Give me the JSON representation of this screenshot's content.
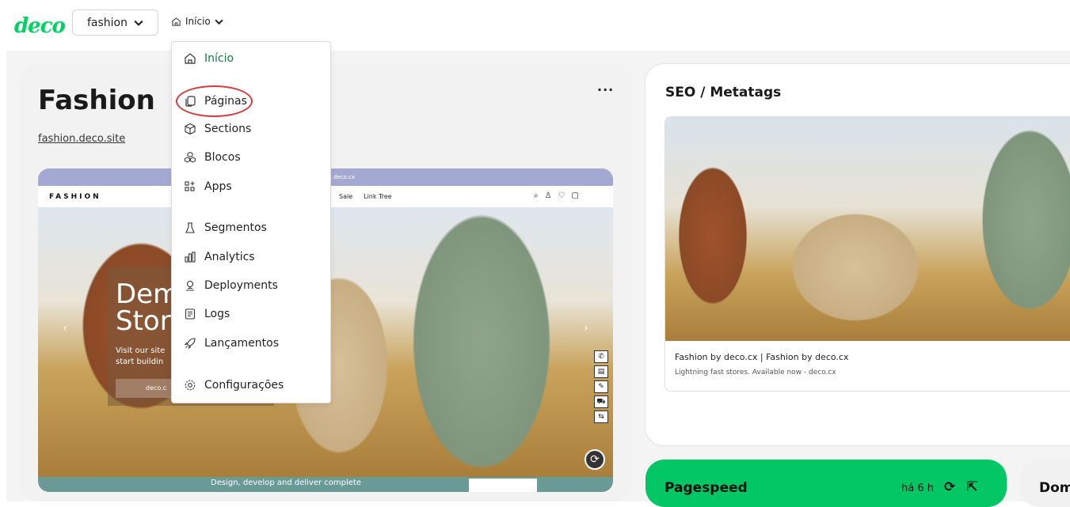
{
  "topbar": {
    "logo": "deco",
    "site_selector": "fashion",
    "breadcrumb": "Início"
  },
  "site": {
    "title": "Fashion",
    "url": "fashion.deco.site",
    "more": "···"
  },
  "preview": {
    "banner": "your store at deco.cx",
    "brand": "FASHION",
    "nav_links": [
      "Sale",
      "Link Tree"
    ],
    "hero_title": "Dem\nStor",
    "hero_sub": "Visit our site\nstart buildin",
    "hero_button": "deco.c",
    "footer_text": "Design, develop and deliver complete"
  },
  "menu": {
    "items": [
      {
        "label": "Início",
        "icon": "home-icon"
      },
      {
        "label": "Páginas",
        "icon": "pages-icon"
      },
      {
        "label": "Sections",
        "icon": "cube-icon"
      },
      {
        "label": "Blocos",
        "icon": "blocks-icon"
      },
      {
        "label": "Apps",
        "icon": "apps-icon"
      },
      {
        "label": "Segmentos",
        "icon": "flask-icon"
      },
      {
        "label": "Analytics",
        "icon": "chart-icon"
      },
      {
        "label": "Deployments",
        "icon": "deploy-icon"
      },
      {
        "label": "Logs",
        "icon": "logs-icon"
      },
      {
        "label": "Lançamentos",
        "icon": "rocket-icon"
      },
      {
        "label": "Configurações",
        "icon": "gear-icon"
      }
    ]
  },
  "seo": {
    "title": "SEO / Metatags",
    "page_title": "Fashion by deco.cx | Fashion by deco.cx",
    "description": "Lightning fast stores. Available now - deco.cx"
  },
  "pagespeed": {
    "title": "Pagespeed",
    "time": "há 6 h"
  },
  "domains": {
    "title": "Dom"
  },
  "colors": {
    "brand_green": "#02d164",
    "pagespeed_green": "#02c764",
    "highlight_red": "#d7383a"
  }
}
